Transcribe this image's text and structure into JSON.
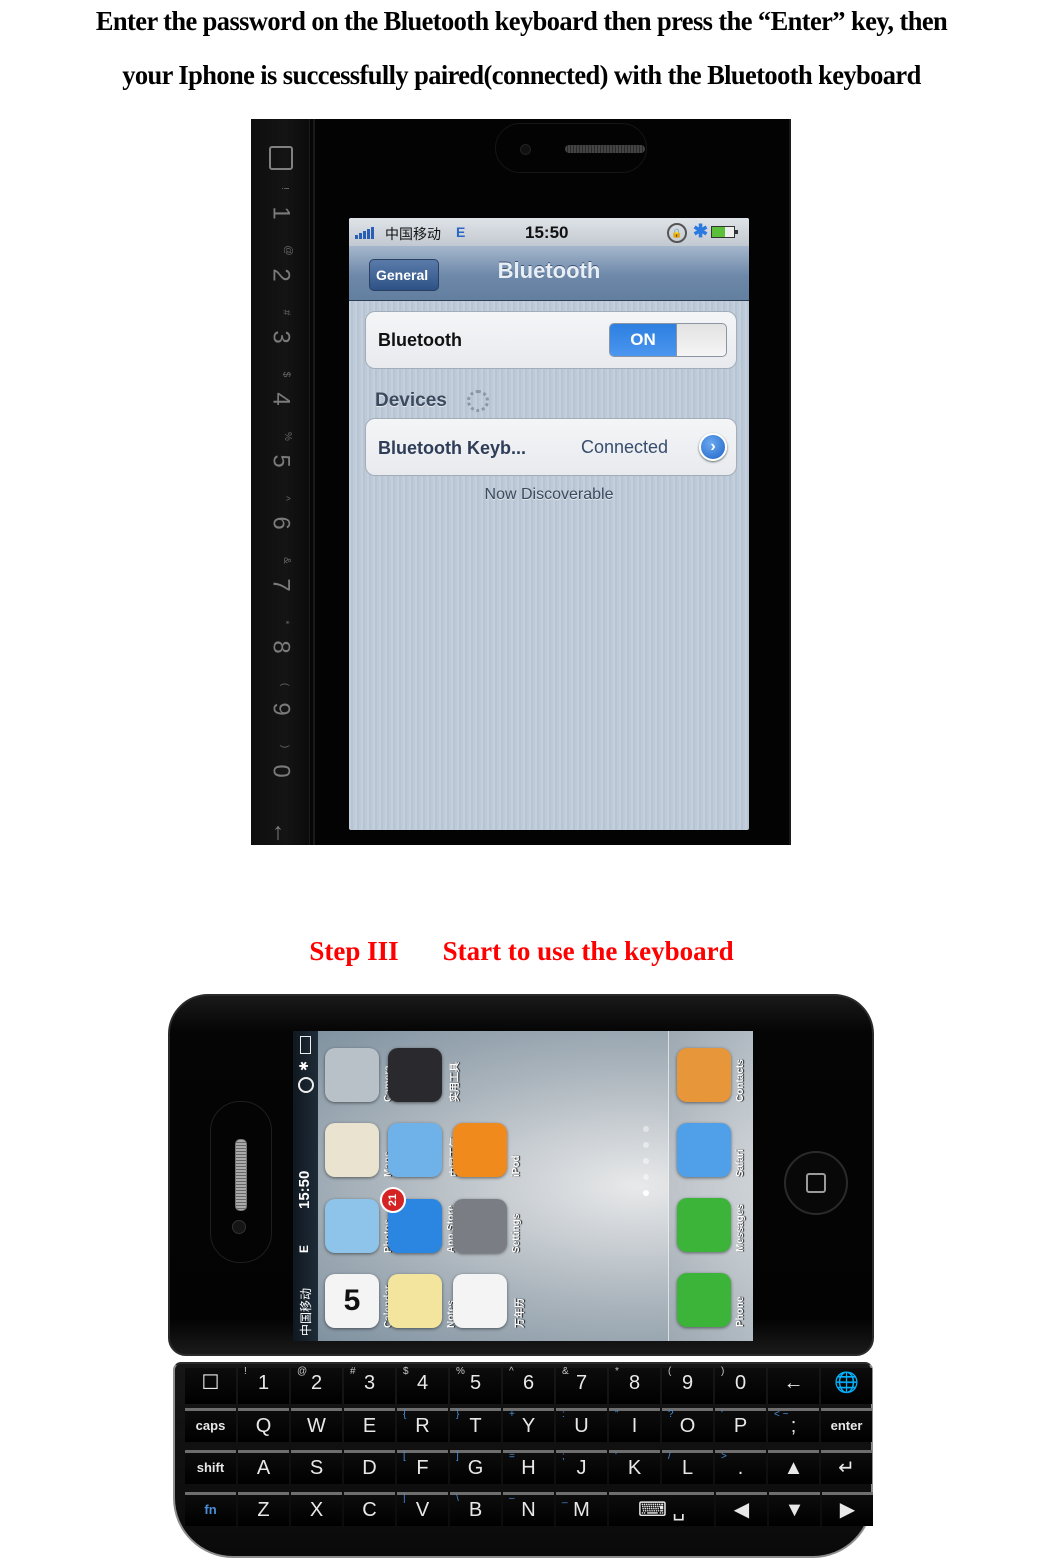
{
  "instructions": {
    "line1": "Enter the password on the Bluetooth keyboard then press the “Enter” key, then",
    "line2": "your Iphone is successfully paired(connected) with the Bluetooth keyboard"
  },
  "photo1": {
    "keyboard_strip": [
      {
        "main": "1",
        "sub": "!"
      },
      {
        "main": "2",
        "sub": "@"
      },
      {
        "main": "3",
        "sub": "#"
      },
      {
        "main": "4",
        "sub": "$"
      },
      {
        "main": "5",
        "sub": "%"
      },
      {
        "main": "6",
        "sub": "^"
      },
      {
        "main": "7",
        "sub": "&"
      },
      {
        "main": "8",
        "sub": "*"
      },
      {
        "main": "9",
        "sub": "("
      },
      {
        "main": "0",
        "sub": ")"
      },
      {
        "main": "←",
        "sub": ""
      }
    ],
    "status_bar": {
      "carrier": "中国移动",
      "network": "E",
      "time": "15:50",
      "lock_icon": "rotation-lock-icon",
      "bluetooth_icon": "✱",
      "battery_icon": "battery-icon"
    },
    "nav": {
      "back_label": "General",
      "title": "Bluetooth"
    },
    "bluetooth_row": {
      "label": "Bluetooth",
      "toggle_label": "ON",
      "toggle_state": "on",
      "accent": "#2d7fe0"
    },
    "devices_header": "Devices",
    "device": {
      "name": "Bluetooth Keyb...",
      "status": "Connected",
      "disclosure": "›"
    },
    "discoverable_text": "Now Discoverable"
  },
  "step": {
    "label": "Step III",
    "title": "Start to use the keyboard",
    "color": "#ff0000"
  },
  "photo2": {
    "status_bar": {
      "carrier": "中国移动",
      "network": "E",
      "time": "15:50",
      "bluetooth_icon": "✱"
    },
    "apps": [
      {
        "name": "Camera",
        "color": "#b8c0c8"
      },
      {
        "name": "实用工具",
        "color": "#2a2a2e"
      },
      {
        "name": "Maps",
        "color": "#e9e3cf"
      },
      {
        "name": "中国天气",
        "color": "#6fb2e9"
      },
      {
        "name": "iPod",
        "color": "#f08a1c"
      },
      {
        "name": "Photos",
        "color": "#8ec3ea"
      },
      {
        "name": "App Store",
        "color": "#2a86e0",
        "badge": "21"
      },
      {
        "name": "Settings",
        "color": "#7a7e84"
      },
      {
        "name": "Calendar",
        "color": "#f4f4f4",
        "day": "5"
      },
      {
        "name": "Notes",
        "color": "#f3e59d"
      },
      {
        "name": "万年历",
        "color": "#f4f4f4"
      }
    ],
    "dock": [
      {
        "name": "Contacts",
        "color": "#e7963a"
      },
      {
        "name": "Safari",
        "color": "#4fa0e8"
      },
      {
        "name": "Messages",
        "color": "#3cb43a"
      },
      {
        "name": "Phone",
        "color": "#3cb43a"
      }
    ],
    "page_count": 5,
    "active_page": 5,
    "keyboard": {
      "row1": [
        {
          "main": "☐",
          "sub": ""
        },
        {
          "main": "1",
          "sub": "!"
        },
        {
          "main": "2",
          "sub": "@"
        },
        {
          "main": "3",
          "sub": "#"
        },
        {
          "main": "4",
          "sub": "$"
        },
        {
          "main": "5",
          "sub": "%"
        },
        {
          "main": "6",
          "sub": "^"
        },
        {
          "main": "7",
          "sub": "&"
        },
        {
          "main": "8",
          "sub": "*"
        },
        {
          "main": "9",
          "sub": "("
        },
        {
          "main": "0",
          "sub": ")"
        },
        {
          "main": "←",
          "sub": ""
        },
        {
          "main": "🌐",
          "sub": ""
        }
      ],
      "row2": [
        {
          "main": "caps",
          "sub": ""
        },
        {
          "main": "Q",
          "sub": ""
        },
        {
          "main": "W",
          "sub": ""
        },
        {
          "main": "E",
          "sub": ""
        },
        {
          "main": "R",
          "sub": "{"
        },
        {
          "main": "T",
          "sub": "}"
        },
        {
          "main": "Y",
          "sub": "+"
        },
        {
          "main": "U",
          "sub": ":"
        },
        {
          "main": "I",
          "sub": "\""
        },
        {
          "main": "O",
          "sub": "?"
        },
        {
          "main": "P",
          "sub": "'"
        },
        {
          "main": ";",
          "sub": "< ~"
        },
        {
          "main": "enter",
          "sub": ""
        }
      ],
      "row3": [
        {
          "main": "shift",
          "sub": ""
        },
        {
          "main": "A",
          "sub": ""
        },
        {
          "main": "S",
          "sub": ""
        },
        {
          "main": "D",
          "sub": ""
        },
        {
          "main": "F",
          "sub": "["
        },
        {
          "main": "G",
          "sub": "]"
        },
        {
          "main": "H",
          "sub": "="
        },
        {
          "main": "J",
          "sub": ";"
        },
        {
          "main": "K",
          "sub": "'"
        },
        {
          "main": "L",
          "sub": "/"
        },
        {
          "main": ".",
          "sub": ">"
        },
        {
          "main": "▲",
          "sub": ""
        },
        {
          "main": "↵",
          "sub": ""
        }
      ],
      "row4": [
        {
          "main": "fn",
          "sub": ""
        },
        {
          "main": "Z",
          "sub": ""
        },
        {
          "main": "X",
          "sub": ""
        },
        {
          "main": "C",
          "sub": ""
        },
        {
          "main": "V",
          "sub": "|"
        },
        {
          "main": "B",
          "sub": "\\"
        },
        {
          "main": "N",
          "sub": "–"
        },
        {
          "main": "M",
          "sub": "_"
        },
        {
          "main": "⌨ ␣",
          "sub": ""
        },
        {
          "main": "◀",
          "sub": ""
        },
        {
          "main": "▼",
          "sub": ""
        },
        {
          "main": "▶",
          "sub": ""
        }
      ]
    }
  }
}
